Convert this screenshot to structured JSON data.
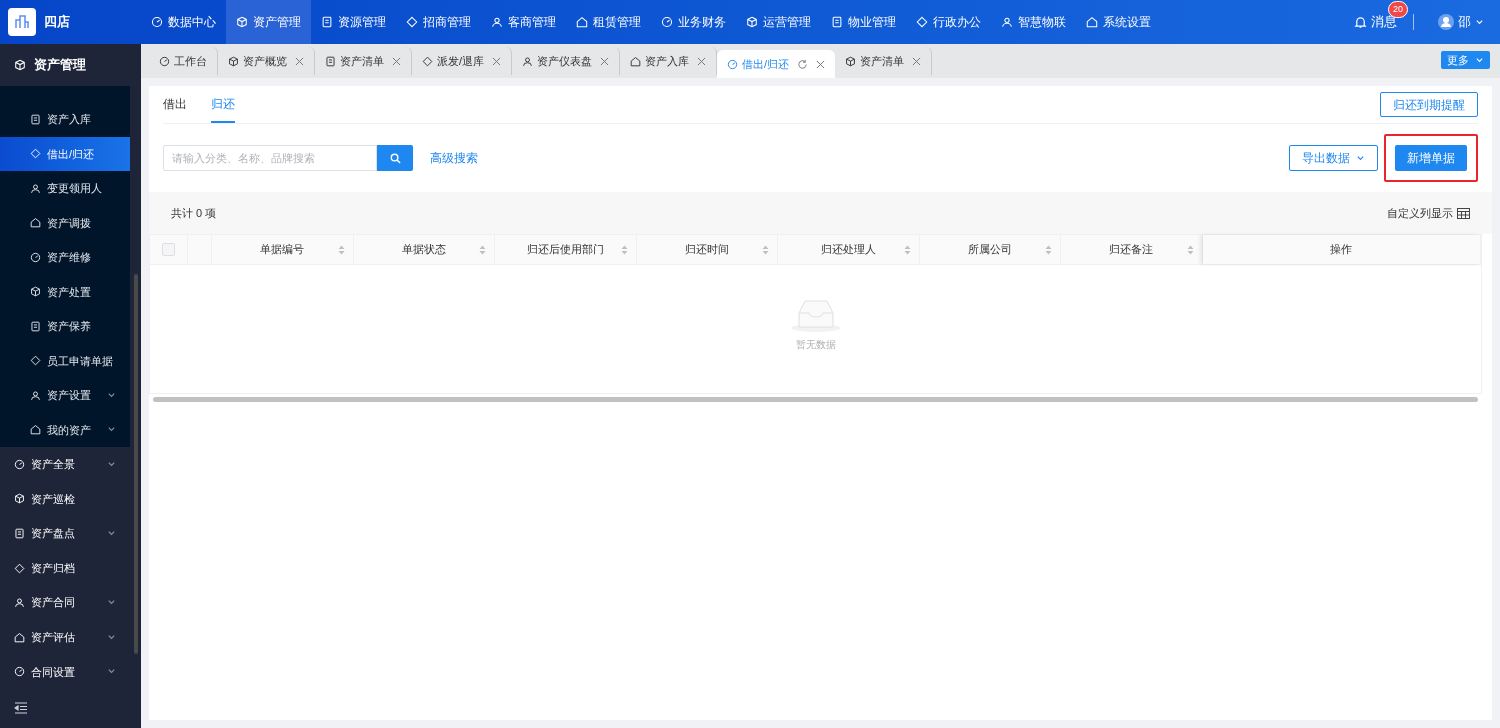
{
  "app": {
    "name": "四店"
  },
  "top_nav": [
    {
      "label": "数据中心",
      "selected": false
    },
    {
      "label": "资产管理",
      "selected": true
    },
    {
      "label": "资源管理",
      "selected": false
    },
    {
      "label": "招商管理",
      "selected": false
    },
    {
      "label": "客商管理",
      "selected": false
    },
    {
      "label": "租赁管理",
      "selected": false
    },
    {
      "label": "业务财务",
      "selected": false
    },
    {
      "label": "运营管理",
      "selected": false
    },
    {
      "label": "物业管理",
      "selected": false
    },
    {
      "label": "行政办公",
      "selected": false
    },
    {
      "label": "智慧物联",
      "selected": false
    },
    {
      "label": "系统设置",
      "selected": false
    }
  ],
  "header_right": {
    "messages_label": "消息",
    "messages_badge": "20",
    "user": "邵"
  },
  "sidebar": {
    "section_title": "资产管理",
    "sub_items": [
      {
        "label": "资产入库",
        "selected": false,
        "expandable": false
      },
      {
        "label": "借出/归还",
        "selected": true,
        "expandable": false
      },
      {
        "label": "变更领用人",
        "selected": false,
        "expandable": false
      },
      {
        "label": "资产调拨",
        "selected": false,
        "expandable": false
      },
      {
        "label": "资产维修",
        "selected": false,
        "expandable": false
      },
      {
        "label": "资产处置",
        "selected": false,
        "expandable": false
      },
      {
        "label": "资产保养",
        "selected": false,
        "expandable": false
      },
      {
        "label": "员工申请单据",
        "selected": false,
        "expandable": false
      },
      {
        "label": "资产设置",
        "selected": false,
        "expandable": true
      },
      {
        "label": "我的资产",
        "selected": false,
        "expandable": true
      }
    ],
    "items": [
      {
        "label": "资产全景",
        "expandable": true
      },
      {
        "label": "资产巡检",
        "expandable": false
      },
      {
        "label": "资产盘点",
        "expandable": true
      },
      {
        "label": "资产归档",
        "expandable": false
      },
      {
        "label": "资产合同",
        "expandable": true
      },
      {
        "label": "资产评估",
        "expandable": true
      },
      {
        "label": "合同设置",
        "expandable": true
      }
    ]
  },
  "tabs": [
    {
      "label": "工作台",
      "selected": false,
      "closable": false
    },
    {
      "label": "资产概览",
      "selected": false,
      "closable": true
    },
    {
      "label": "资产清单",
      "selected": false,
      "closable": true
    },
    {
      "label": "派发/退库",
      "selected": false,
      "closable": true
    },
    {
      "label": "资产仪表盘",
      "selected": false,
      "closable": true
    },
    {
      "label": "资产入库",
      "selected": false,
      "closable": true
    },
    {
      "label": "借出/归还",
      "selected": true,
      "closable": true
    },
    {
      "label": "资产清单",
      "selected": false,
      "closable": true
    }
  ],
  "more_button": "更多",
  "subtabs": [
    {
      "label": "借出",
      "selected": false
    },
    {
      "label": "归还",
      "selected": true
    }
  ],
  "reminder_button": "归还到期提醒",
  "search": {
    "placeholder": "请输入分类、名称、品牌搜索"
  },
  "advanced_search": "高级搜索",
  "export_button": "导出数据",
  "new_button": {
    "label": "新增单据",
    "highlighted": true
  },
  "total": "共计 0 项",
  "column_settings": "自定义列显示",
  "table": {
    "select_all_checked": false,
    "columns": [
      {
        "label": "单据编号",
        "sortable": true
      },
      {
        "label": "单据状态",
        "sortable": true
      },
      {
        "label": "归还后使用部门",
        "sortable": true
      },
      {
        "label": "归还时间",
        "sortable": true
      },
      {
        "label": "归还处理人",
        "sortable": true
      },
      {
        "label": "所属公司",
        "sortable": true
      },
      {
        "label": "归还备注",
        "sortable": true
      },
      {
        "label": "操作",
        "sortable": false
      }
    ],
    "empty_text": "暂无数据"
  }
}
